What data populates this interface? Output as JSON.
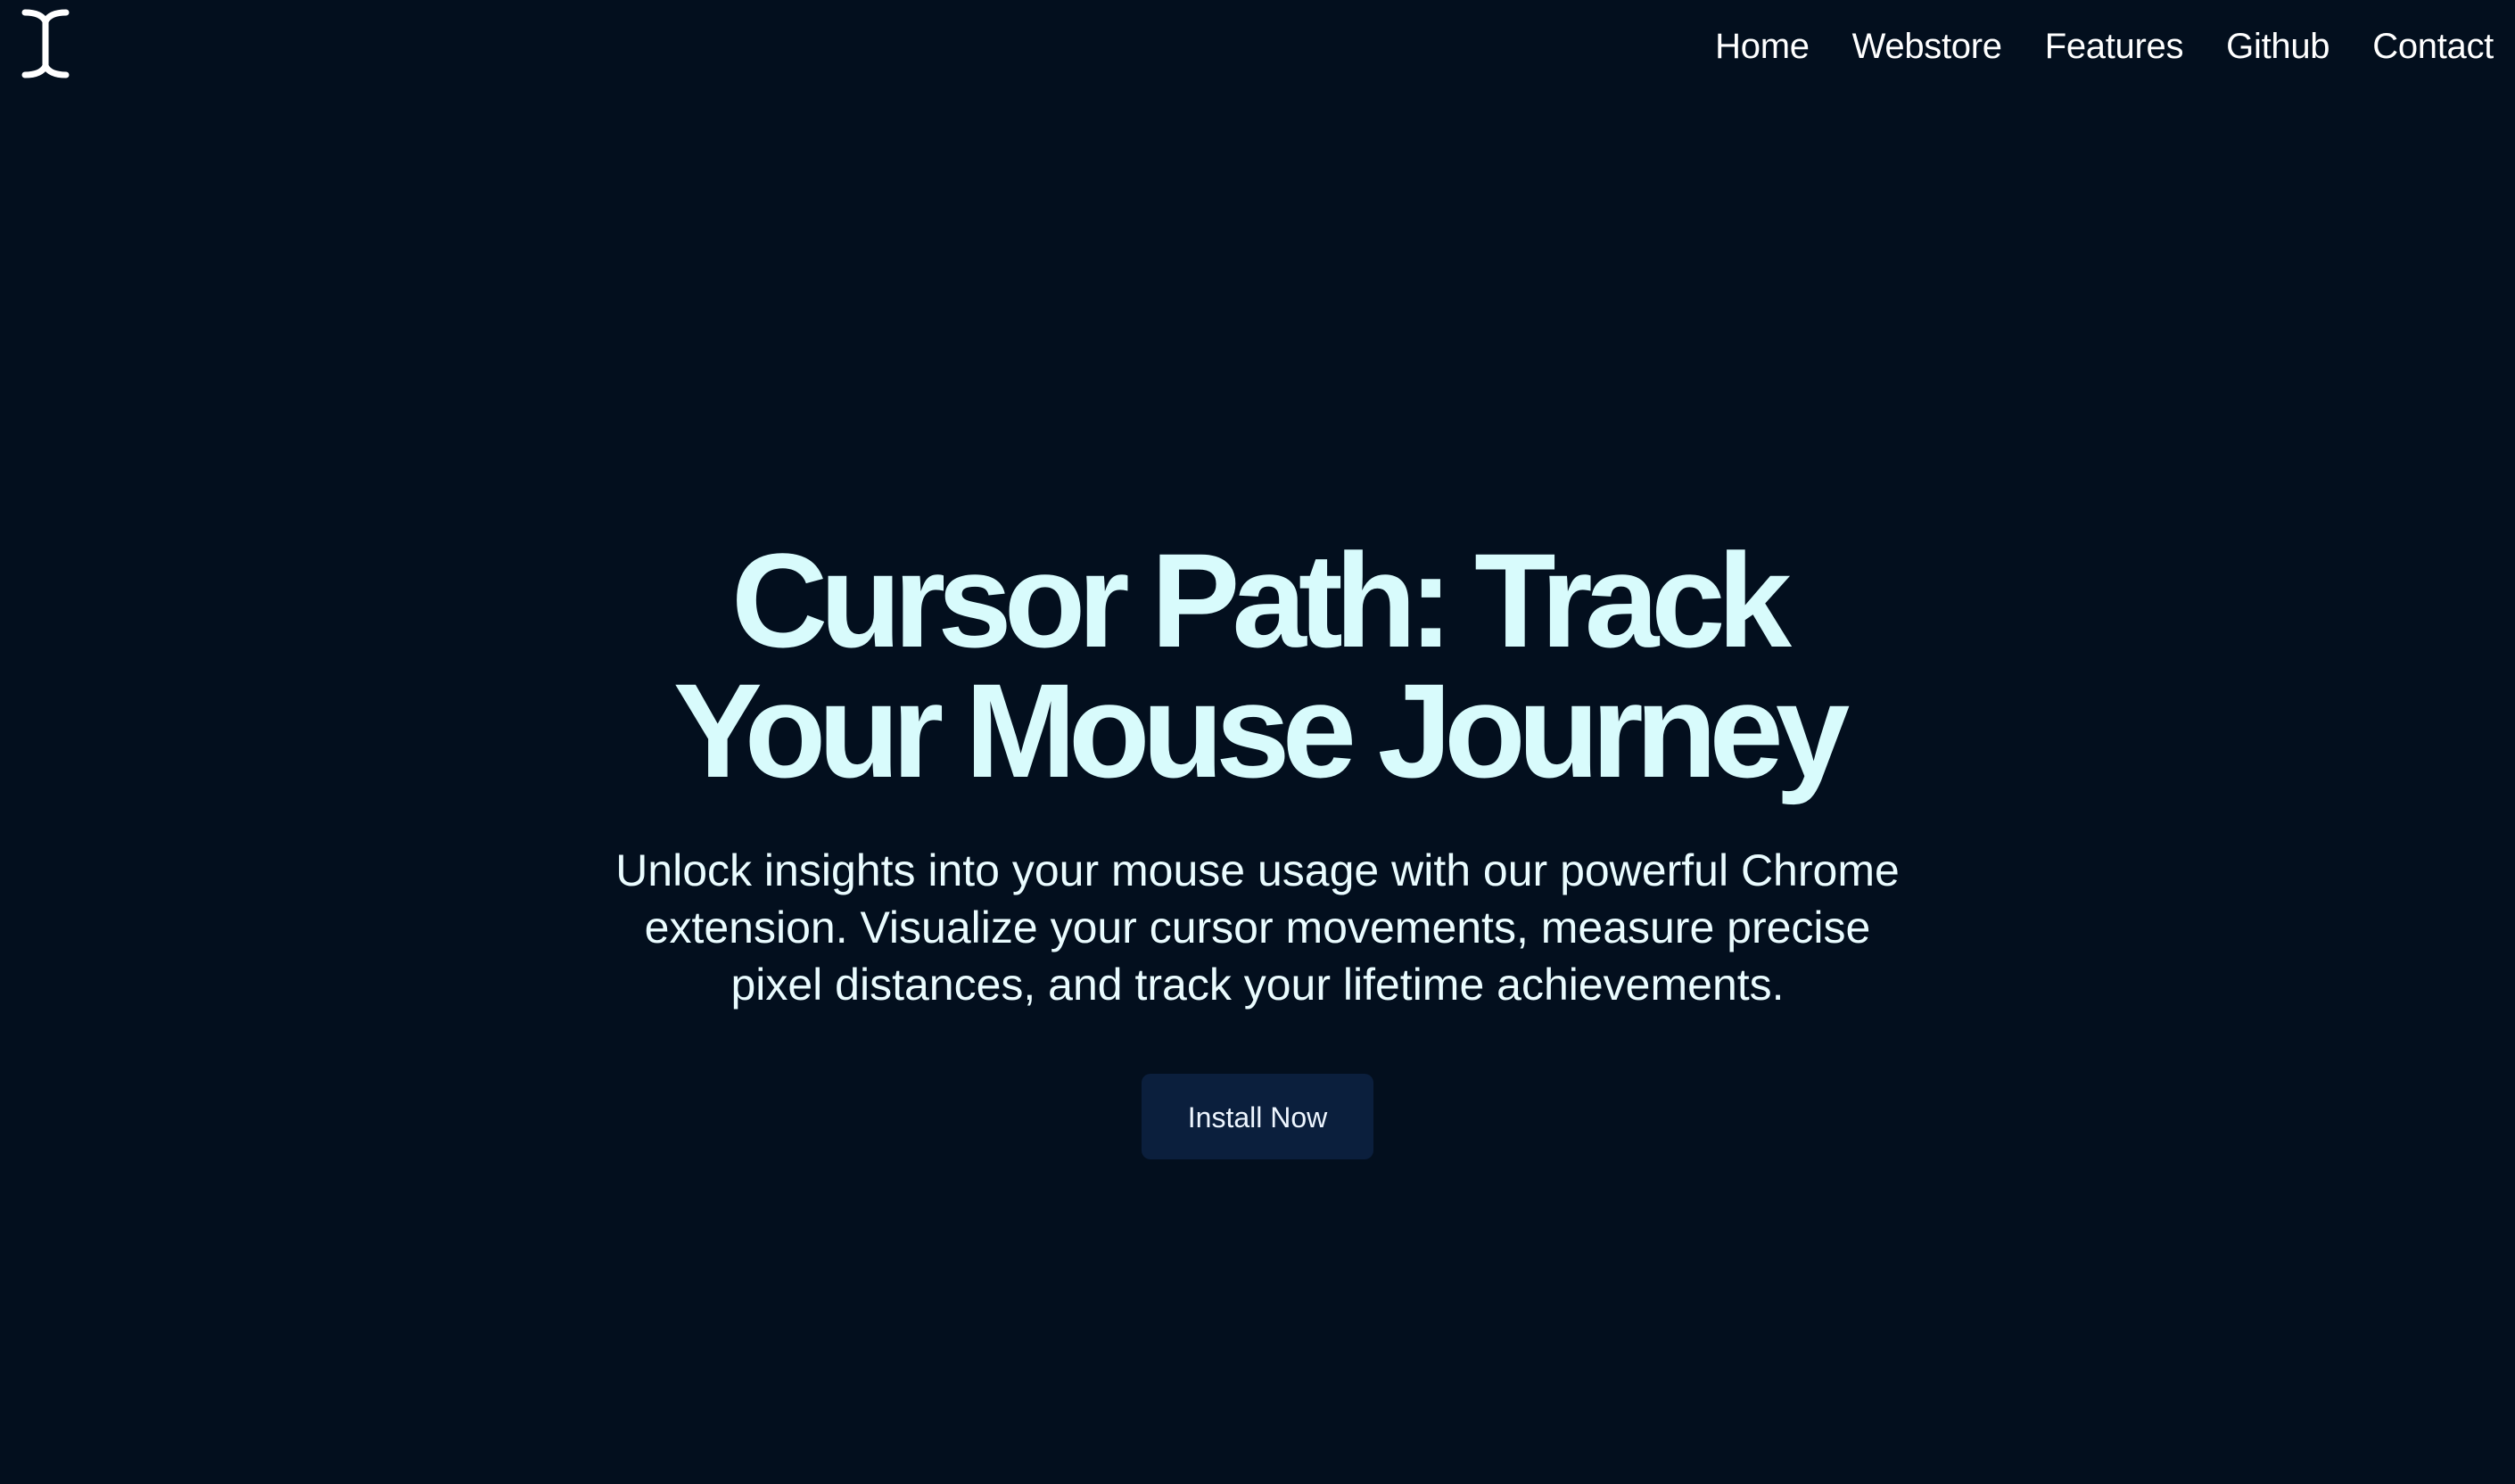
{
  "nav": {
    "items": [
      {
        "label": "Home"
      },
      {
        "label": "Webstore"
      },
      {
        "label": "Features"
      },
      {
        "label": "Github"
      },
      {
        "label": "Contact"
      }
    ]
  },
  "logo": {
    "icon": "text-cursor-icon",
    "color": "#ffffff"
  },
  "hero": {
    "title": "Cursor Path: Track Your Mouse Journey",
    "subtitle": "Unlock insights into your mouse usage with our powerful Chrome extension. Visualize your cursor movements, measure precise pixel distances, and track your lifetime achievements.",
    "cta_label": "Install Now"
  },
  "colors": {
    "background": "#030f1e",
    "title": "#d8fbfc",
    "text": "#eafcff",
    "button_bg": "#0b1f3d"
  }
}
